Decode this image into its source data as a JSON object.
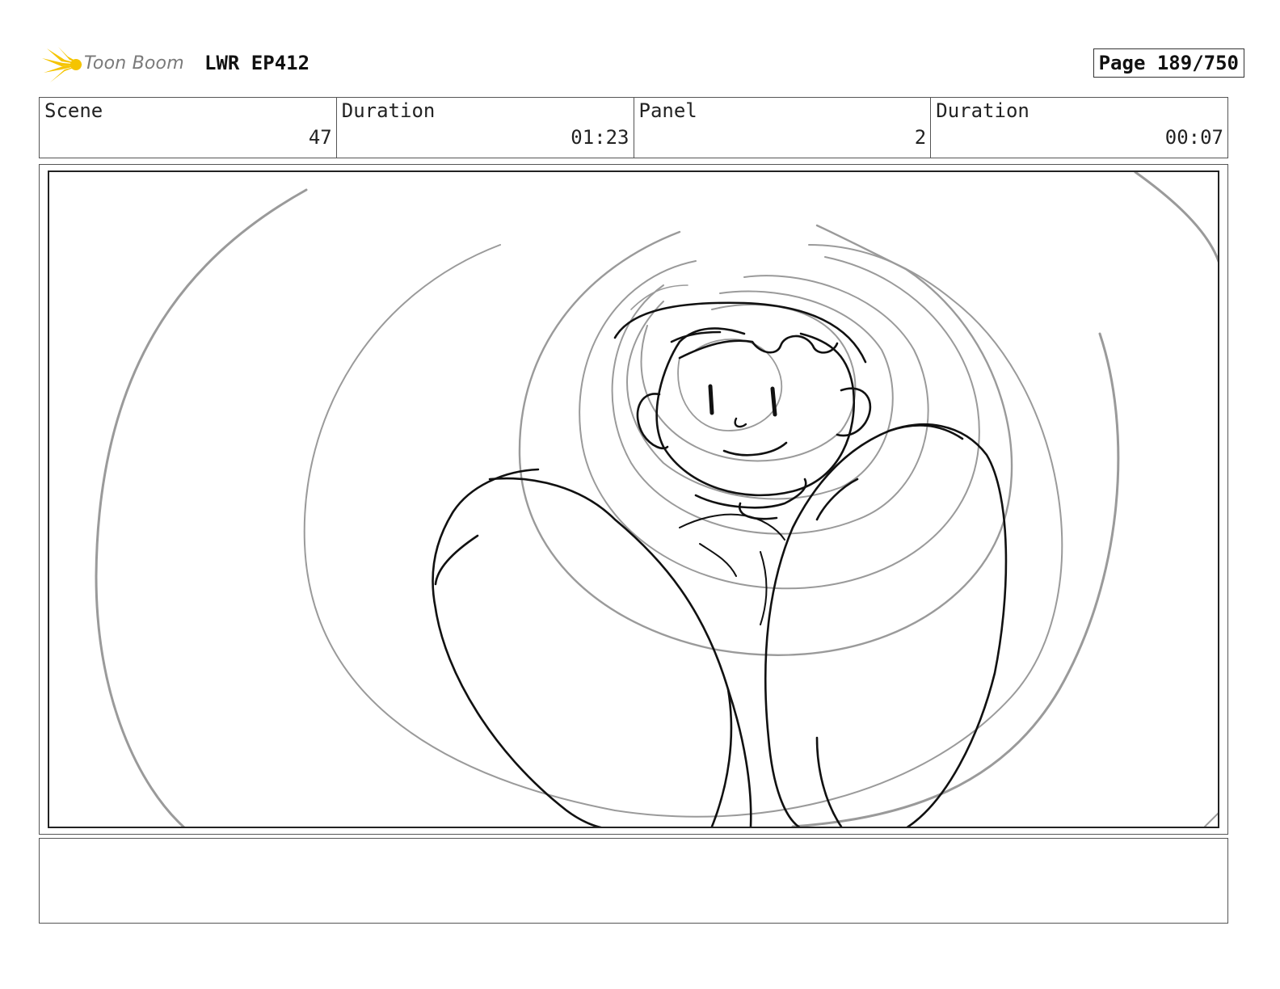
{
  "header": {
    "logo_text": "Toon Boom",
    "project_title": "LWR EP412",
    "page_label": "Page 189/750"
  },
  "info": {
    "scene_label": "Scene",
    "scene_value": "47",
    "scene_duration_label": "Duration",
    "scene_duration_value": "01:23",
    "panel_label": "Panel",
    "panel_value": "2",
    "panel_duration_label": "Duration",
    "panel_duration_value": "00:07"
  },
  "notes": {
    "text": ""
  },
  "colors": {
    "logo_accent": "#f5c400",
    "sketch_line": "#111111",
    "swirl_line": "#9a9a9a"
  }
}
